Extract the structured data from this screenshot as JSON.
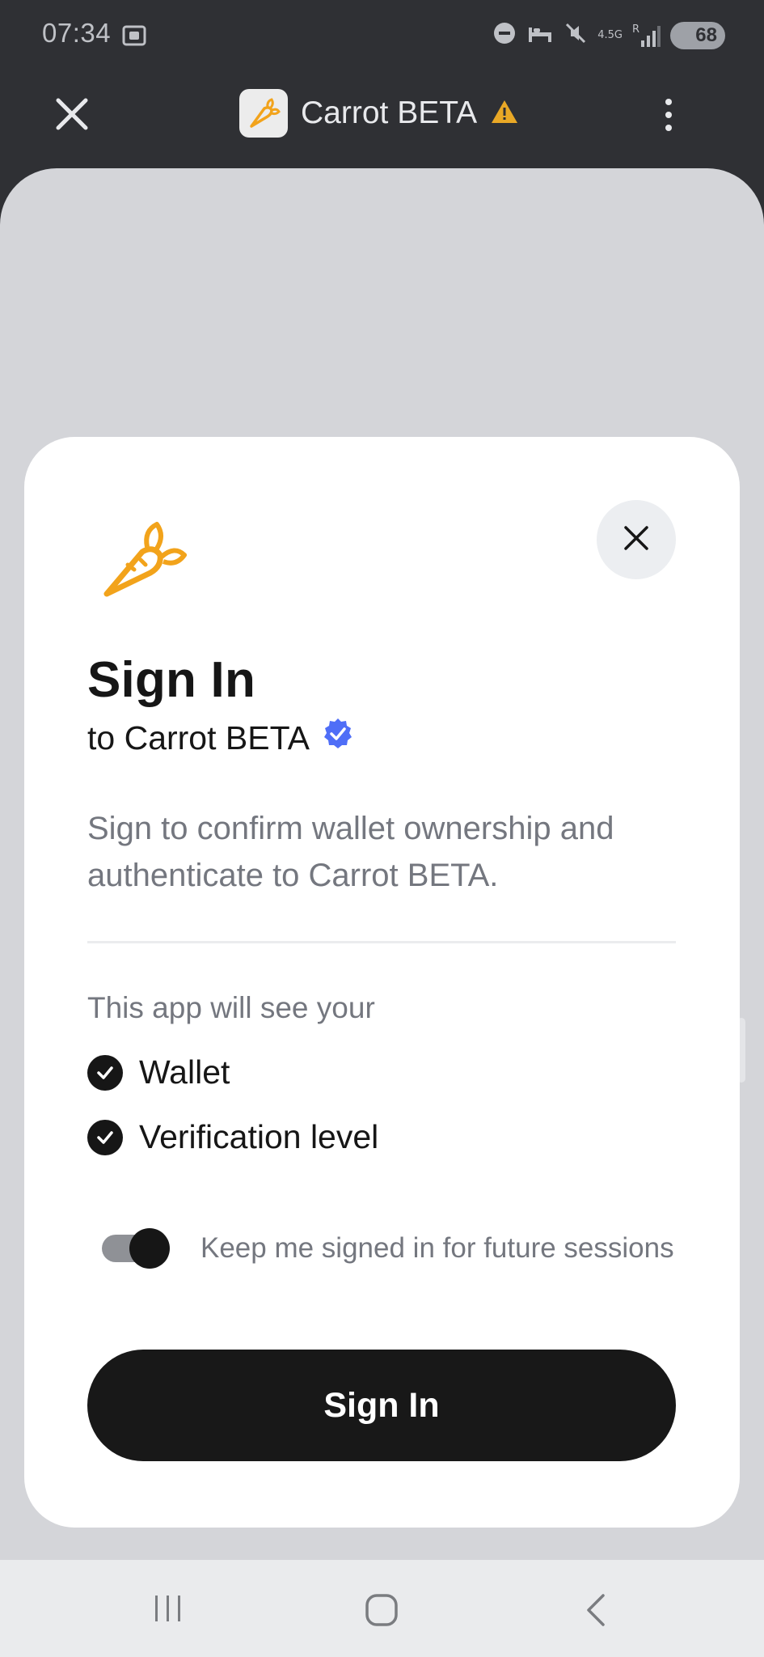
{
  "status_bar": {
    "time": "07:34",
    "network": "4.5G",
    "network_sub": "R",
    "battery": "68"
  },
  "header": {
    "title": "Carrot BETA",
    "warning_icon": "warning-triangle-icon"
  },
  "modal": {
    "title": "Sign In",
    "subtitle": "to Carrot BETA",
    "description": "Sign to confirm wallet ownership and authenticate to Carrot BETA.",
    "permissions_heading": "This app will see your",
    "permissions": [
      "Wallet",
      "Verification level"
    ],
    "keep_signed_in_label": "Keep me signed in for future sessions",
    "keep_signed_in": true,
    "signin_button": "Sign In"
  },
  "colors": {
    "brand_orange": "#f2a31b",
    "verified_blue": "#4f6ef7",
    "warning_amber": "#e9a826",
    "button_dark": "#181818"
  }
}
